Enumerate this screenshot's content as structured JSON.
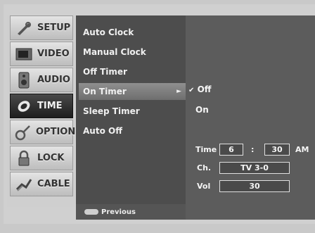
{
  "nav": {
    "items": [
      {
        "label": "SETUP",
        "icon": "setup-icon"
      },
      {
        "label": "VIDEO",
        "icon": "video-icon"
      },
      {
        "label": "AUDIO",
        "icon": "audio-icon"
      },
      {
        "label": "TIME",
        "icon": "time-icon"
      },
      {
        "label": "OPTION",
        "icon": "option-icon"
      },
      {
        "label": "LOCK",
        "icon": "lock-icon"
      },
      {
        "label": "CABLE",
        "icon": "cable-icon"
      }
    ],
    "active": "TIME"
  },
  "submenu": {
    "items": [
      {
        "label": "Auto Clock"
      },
      {
        "label": "Manual Clock"
      },
      {
        "label": "Off Timer"
      },
      {
        "label": "On Timer"
      },
      {
        "label": "Sleep Timer"
      },
      {
        "label": "Auto Off"
      }
    ],
    "selected": "On Timer",
    "arrow": "►"
  },
  "footer": {
    "text": "Previous"
  },
  "on_timer": {
    "options": [
      "Off",
      "On"
    ],
    "checkmark": "✔",
    "selected": "Off",
    "time_label": "Time",
    "hour": "6",
    "separator": ":",
    "minute": "30",
    "ampm": "AM",
    "channel_label": "Ch.",
    "channel_value": "TV 3-0",
    "volume_label": "Vol",
    "volume_value": "30"
  },
  "colors": {
    "active_nav": "#1d1d1d",
    "submenu_bg": "#4d4d4d",
    "options_bg": "#5c5c5c"
  }
}
